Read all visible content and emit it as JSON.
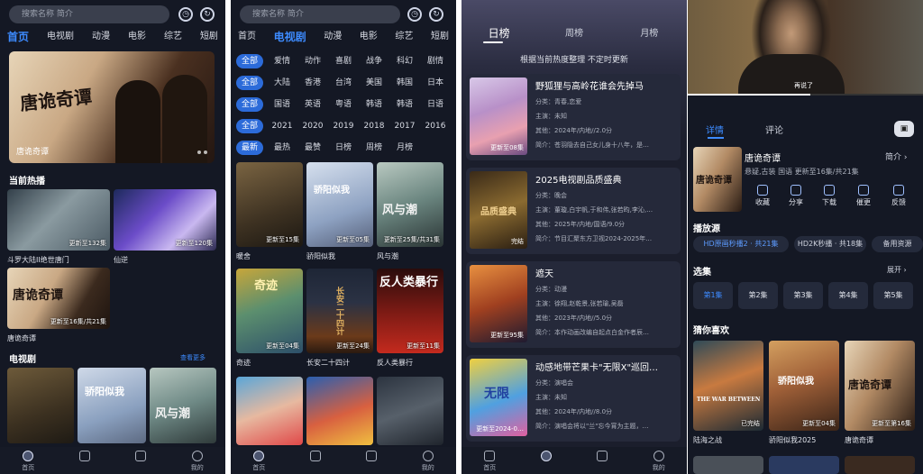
{
  "screen1": {
    "search_placeholder": "搜索名称 简介",
    "nav": [
      "首页",
      "电视剧",
      "动漫",
      "电影",
      "综艺",
      "短剧"
    ],
    "hero": {
      "art_text": "唐诡奇谭",
      "caption": "唐诡奇谭"
    },
    "hot_title": "当前热播",
    "hot": [
      {
        "title": "斗罗大陆II绝世唐门",
        "badge": "更新至132集"
      },
      {
        "title": "仙逆",
        "badge": "更新至120集"
      },
      {
        "title": "唐诡奇谭",
        "badge": "更新至16集/共21集",
        "art_text": "唐诡奇谭"
      }
    ],
    "tv_title": "电视剧",
    "see_more": "查看更多",
    "tv_posters": [
      {
        "art_text": ""
      },
      {
        "art_text": "骄阳似我"
      },
      {
        "art_text": "风与潮"
      }
    ]
  },
  "screen2": {
    "search_placeholder": "搜索名称 简介",
    "nav": [
      "首页",
      "电视剧",
      "动漫",
      "电影",
      "综艺",
      "短剧"
    ],
    "filters": [
      [
        "全部",
        "爱情",
        "动作",
        "喜剧",
        "战争",
        "科幻",
        "剧情"
      ],
      [
        "全部",
        "大陆",
        "香港",
        "台湾",
        "美国",
        "韩国",
        "日本"
      ],
      [
        "全部",
        "国语",
        "英语",
        "粤语",
        "韩语",
        "韩语",
        "日语"
      ],
      [
        "全部",
        "2021",
        "2020",
        "2019",
        "2018",
        "2017",
        "2016"
      ],
      [
        "最新",
        "最热",
        "最赞",
        "日榜",
        "周榜",
        "月榜"
      ]
    ],
    "grid": [
      {
        "title": "暖舍",
        "badge": "更新至15集",
        "art_text": ""
      },
      {
        "title": "骄阳似我",
        "badge": "更新至05集",
        "art_text": "骄阳似我"
      },
      {
        "title": "风与潮",
        "badge": "更新至25集/共31集",
        "art_text": "风与潮"
      },
      {
        "title": "奇迹",
        "badge": "更新至04集",
        "art_text": "奇迹"
      },
      {
        "title": "长安二十四计",
        "badge": "更新至24集",
        "art_text": "长安二十四计"
      },
      {
        "title": "反人类暴行",
        "badge": "更新至11集",
        "art_text": "反人类暴行"
      },
      {
        "title": "",
        "badge": "",
        "art_text": ""
      },
      {
        "title": "",
        "badge": "",
        "art_text": ""
      },
      {
        "title": "",
        "badge": "",
        "art_text": ""
      }
    ]
  },
  "screen3": {
    "tabs": [
      "日榜",
      "周榜",
      "月榜"
    ],
    "note": "根据当前热度整理 不定时更新",
    "cards": [
      {
        "title": "野狐狸与高岭花谁会先掉马",
        "lines": [
          "分类：青春,恋爱",
          "主演：未知",
          "其他：2024年/内地//2.0分",
          "简介：苍羽隐去自己女儿身十八年，是…"
        ],
        "badge": "更新至08集",
        "art_text": ""
      },
      {
        "title": "2025电视剧品质盛典",
        "lines": [
          "分类：晚会",
          "主演：董璇,白宇帆,于和伟,张若昀,李沁,…",
          "其他：2025年/内地/国语/9.0分",
          "简介：节目汇聚东方卫视2024-2025年…"
        ],
        "badge": "完结",
        "art_text": "品质盛典"
      },
      {
        "title": "遮天",
        "lines": [
          "分类：动漫",
          "主演：徐翔,赵乾景,张若瑜,吴磊",
          "其他：2023年/内地//5.0分",
          "简介：本作动画改编自起点白金作者辰…"
        ],
        "badge": "更新至95集",
        "art_text": ""
      },
      {
        "title": "动感地带芒果卡\"无限X\"巡回…",
        "lines": [
          "分类：演唱会",
          "主演：未知",
          "其他：2024年/内地//8.0分",
          "简介：演唱会将以\"兰\"忘今宵为主题，…"
        ],
        "badge": "更新至2024-0…",
        "art_text": "无限"
      }
    ]
  },
  "screen4": {
    "subtitle": "再说了",
    "tabs": [
      "详情",
      "评论"
    ],
    "show": {
      "title": "唐诡奇谭",
      "intro": "简介",
      "meta": "悬疑,古装 国语 更新至16集/共21集",
      "art_text": "唐诡奇谭"
    },
    "actions": [
      "收藏",
      "分享",
      "下载",
      "催更",
      "反馈"
    ],
    "source_title": "播放源",
    "sources": [
      "HD原画秒播2 · 共21集",
      "HD2K秒播 · 共18集",
      "备用资源"
    ],
    "episodes_title": "选集",
    "episodes_more": "展开",
    "episodes": [
      "第1集",
      "第2集",
      "第3集",
      "第4集",
      "第5集"
    ],
    "recommend_title": "猜你喜欢",
    "recommend": [
      {
        "title": "陆海之战",
        "badge": "已完结",
        "art_text": "THE WAR BETWEEN"
      },
      {
        "title": "骄阳似我2025",
        "badge": "更新至04集",
        "art_text": "骄阳似我"
      },
      {
        "title": "唐诡奇谭",
        "badge": "更新至第16集",
        "art_text": "唐诡奇谭"
      }
    ]
  },
  "tabbar": [
    "首页",
    "",
    "",
    "我的"
  ],
  "colors": {
    "accent": "#3d8bff",
    "bg": "#141824",
    "card": "#25293a"
  }
}
